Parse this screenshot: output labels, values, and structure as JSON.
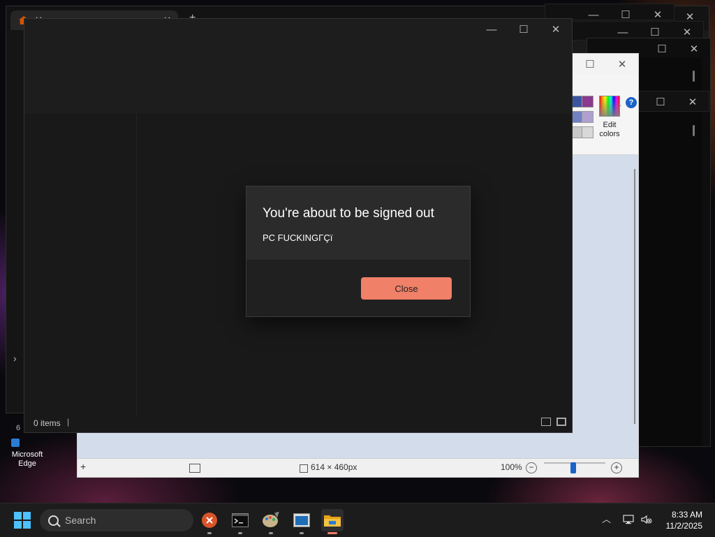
{
  "edge": {
    "tab_title": "Home",
    "tab_close": "✕",
    "new_tab": "+"
  },
  "window_controls": {
    "minimize": "—",
    "maximize": "☐",
    "close": "✕"
  },
  "paint": {
    "ribbon": {
      "edit_colors_line1": "Edit",
      "edit_colors_line2": "colors",
      "help": "?",
      "collapse": "︿"
    },
    "palette_colors": [
      "#3a55a0",
      "#8a3a90",
      "#7080c0",
      "#b0a0d0",
      "#c8c8c8",
      "#d8d8d8"
    ],
    "status": {
      "canvas_size": "614 × 460px",
      "zoom": "100%",
      "zoom_level": 0.5,
      "zoom_out": "−",
      "zoom_in": "+"
    }
  },
  "explorer": {
    "status_items": "0 items",
    "status_separator": "|"
  },
  "dialog": {
    "title": "You're about to be signed out",
    "message": "PC FUCKINGΓÇï",
    "close_button": "Close"
  },
  "desktop": {
    "edge_shortcut_line1": "Microsoft",
    "edge_shortcut_line2": "Edge",
    "side_chevron": "›",
    "side_number": "6"
  },
  "taskbar": {
    "search_label": "Search",
    "apps": [
      "close-app-icon",
      "terminal-icon",
      "paint-icon",
      "window-app-icon",
      "file-explorer-icon"
    ],
    "tray_chevron": "︿",
    "time": "8:33 AM",
    "date": "11/2/2025"
  },
  "colors": {
    "accent_button": "#f08068",
    "start_blue": "#4cc2ff",
    "dialog_bg": "#2b2b2b"
  }
}
